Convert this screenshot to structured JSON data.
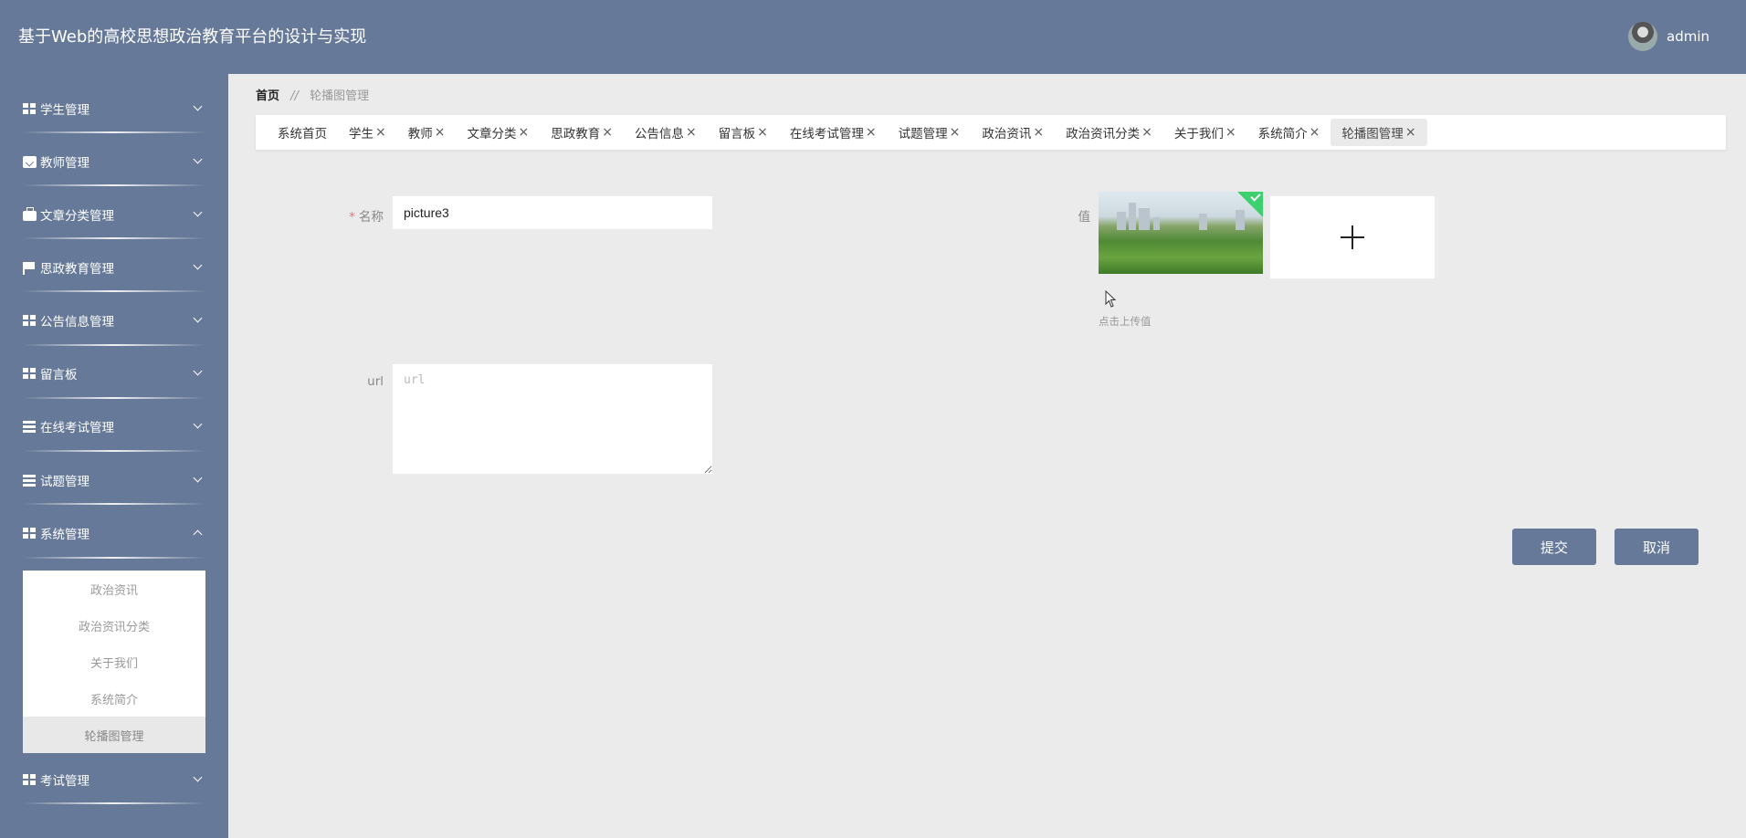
{
  "header": {
    "title": "基于Web的高校思想政治教育平台的设计与实现",
    "username": "admin"
  },
  "sidebar": {
    "items": [
      {
        "label": "学生管理",
        "icon": "grid-icon",
        "expanded": false
      },
      {
        "label": "教师管理",
        "icon": "clipboard-icon",
        "expanded": false
      },
      {
        "label": "文章分类管理",
        "icon": "briefcase-icon",
        "expanded": false
      },
      {
        "label": "思政教育管理",
        "icon": "flag-icon",
        "expanded": false
      },
      {
        "label": "公告信息管理",
        "icon": "grid-icon",
        "expanded": false
      },
      {
        "label": "留言板",
        "icon": "grid-icon",
        "expanded": false
      },
      {
        "label": "在线考试管理",
        "icon": "list-icon",
        "expanded": false
      },
      {
        "label": "试题管理",
        "icon": "list-icon",
        "expanded": false
      },
      {
        "label": "系统管理",
        "icon": "grid-icon",
        "expanded": true
      },
      {
        "label": "考试管理",
        "icon": "grid-icon",
        "expanded": false
      }
    ],
    "submenu": [
      "政治资讯",
      "政治资讯分类",
      "关于我们",
      "系统简介",
      "轮播图管理"
    ],
    "active_submenu": "轮播图管理"
  },
  "breadcrumb": {
    "home": "首页",
    "separator": "//",
    "current": "轮播图管理"
  },
  "tabs": [
    {
      "label": "系统首页",
      "closable": false
    },
    {
      "label": "学生",
      "closable": true
    },
    {
      "label": "教师",
      "closable": true
    },
    {
      "label": "文章分类",
      "closable": true
    },
    {
      "label": "思政教育",
      "closable": true
    },
    {
      "label": "公告信息",
      "closable": true
    },
    {
      "label": "留言板",
      "closable": true
    },
    {
      "label": "在线考试管理",
      "closable": true
    },
    {
      "label": "试题管理",
      "closable": true
    },
    {
      "label": "政治资讯",
      "closable": true
    },
    {
      "label": "政治资讯分类",
      "closable": true
    },
    {
      "label": "关于我们",
      "closable": true
    },
    {
      "label": "系统简介",
      "closable": true
    },
    {
      "label": "轮播图管理",
      "closable": true,
      "active": true
    }
  ],
  "tab_close_glyph": "×",
  "form": {
    "name_label": "名称",
    "name_required_mark": "*",
    "name_value": "picture3",
    "url_label": "url",
    "url_placeholder": "url",
    "value_label": "值",
    "upload_tip": "点击上传值",
    "submit_label": "提交",
    "cancel_label": "取消"
  },
  "colors": {
    "primary": "#667998",
    "background": "#ebebeb",
    "upload_success": "#3ecf6e",
    "required": "#f56c6c"
  }
}
